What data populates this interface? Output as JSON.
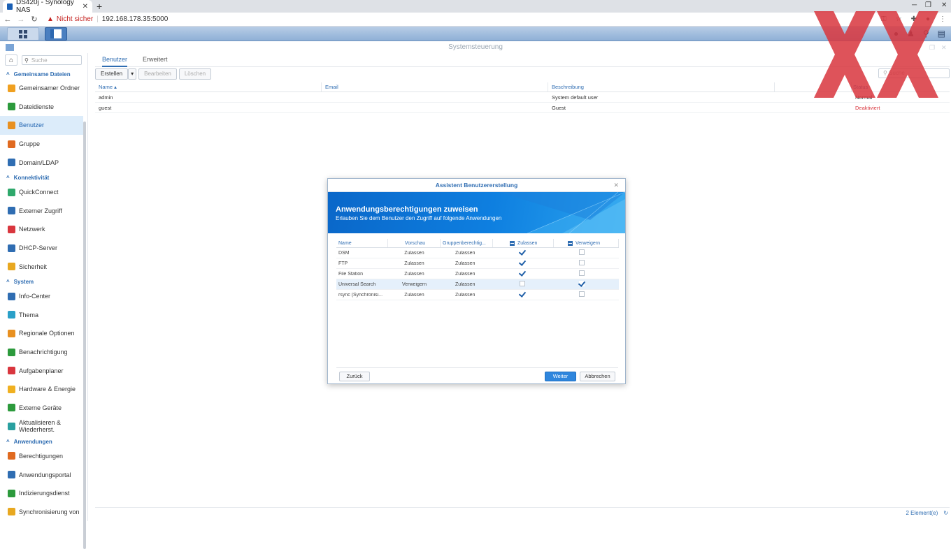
{
  "browser": {
    "tab_title": "DS420j - Synology NAS",
    "not_secure": "Nicht sicher",
    "url": "192.168.178.35:5000"
  },
  "window": {
    "title": "Systemsteuerung"
  },
  "sidebar": {
    "search_placeholder": "Suche",
    "sections": [
      {
        "title": "Gemeinsame Dateien",
        "items": [
          {
            "label": "Gemeinsamer Ordner",
            "icon": "shared-folder-icon",
            "color": "#f0a020"
          },
          {
            "label": "Dateidienste",
            "icon": "file-services-icon",
            "color": "#2c9a3c"
          },
          {
            "label": "Benutzer",
            "icon": "user-icon",
            "color": "#e89020",
            "active": true
          },
          {
            "label": "Gruppe",
            "icon": "group-icon",
            "color": "#e06a20"
          },
          {
            "label": "Domain/LDAP",
            "icon": "domain-icon",
            "color": "#2f6db2"
          }
        ]
      },
      {
        "title": "Konnektivität",
        "items": [
          {
            "label": "QuickConnect",
            "icon": "quickconnect-icon",
            "color": "#2ea86b"
          },
          {
            "label": "Externer Zugriff",
            "icon": "globe-icon",
            "color": "#2f6db2"
          },
          {
            "label": "Netzwerk",
            "icon": "network-icon",
            "color": "#d9363e"
          },
          {
            "label": "DHCP-Server",
            "icon": "dhcp-icon",
            "color": "#2f6db2"
          },
          {
            "label": "Sicherheit",
            "icon": "shield-icon",
            "color": "#e8a820"
          }
        ]
      },
      {
        "title": "System",
        "items": [
          {
            "label": "Info-Center",
            "icon": "info-icon",
            "color": "#2f6db2"
          },
          {
            "label": "Thema",
            "icon": "palette-icon",
            "color": "#2aa0c8"
          },
          {
            "label": "Regionale Optionen",
            "icon": "clock-icon",
            "color": "#e89020"
          },
          {
            "label": "Benachrichtigung",
            "icon": "chat-icon",
            "color": "#2c9a3c"
          },
          {
            "label": "Aufgabenplaner",
            "icon": "calendar-icon",
            "color": "#d9363e"
          },
          {
            "label": "Hardware & Energie",
            "icon": "bulb-icon",
            "color": "#f0b020"
          },
          {
            "label": "Externe Geräte",
            "icon": "external-device-icon",
            "color": "#2c9a3c"
          },
          {
            "label": "Aktualisieren & Wiederherst.",
            "icon": "refresh-icon",
            "color": "#2aa0a0"
          }
        ]
      },
      {
        "title": "Anwendungen",
        "items": [
          {
            "label": "Berechtigungen",
            "icon": "permissions-icon",
            "color": "#e06a20"
          },
          {
            "label": "Anwendungsportal",
            "icon": "portal-icon",
            "color": "#2f6db2"
          },
          {
            "label": "Indizierungsdienst",
            "icon": "index-icon",
            "color": "#2c9a3c"
          },
          {
            "label": "Synchronisierung von",
            "icon": "sync-icon",
            "color": "#e8a820"
          }
        ]
      }
    ]
  },
  "main": {
    "tabs": [
      "Benutzer",
      "Erweitert"
    ],
    "toolbar": {
      "create": "Erstellen",
      "edit": "Bearbeiten",
      "delete": "Löschen"
    },
    "filter_placeholder": "Suche",
    "columns": [
      "Name",
      "Email",
      "Beschreibung",
      "",
      "Status"
    ],
    "users": [
      {
        "name": "admin",
        "email": "",
        "description": "System default user",
        "status": "Normal"
      },
      {
        "name": "guest",
        "email": "",
        "description": "Guest",
        "status": "Deaktiviert"
      }
    ],
    "footer_count": "2 Element(e)"
  },
  "dialog": {
    "title": "Assistent Benutzererstellung",
    "heading": "Anwendungsberechtigungen zuweisen",
    "subheading": "Erlauben Sie dem Benutzer den Zugriff auf folgende Anwendungen",
    "columns": [
      "Name",
      "Vorschau",
      "Gruppenberechtig...",
      "Zulassen",
      "Verweigern"
    ],
    "rows": [
      {
        "name": "DSM",
        "preview": "Zulassen",
        "group": "Zulassen",
        "allow": true,
        "deny": false
      },
      {
        "name": "FTP",
        "preview": "Zulassen",
        "group": "Zulassen",
        "allow": true,
        "deny": false
      },
      {
        "name": "File Station",
        "preview": "Zulassen",
        "group": "Zulassen",
        "allow": true,
        "deny": false
      },
      {
        "name": "Universal Search",
        "preview": "Verweigern",
        "group": "Zulassen",
        "allow": false,
        "deny": true,
        "selected": true
      },
      {
        "name": "rsync (Synchronisi...",
        "preview": "Zulassen",
        "group": "Zulassen",
        "allow": true,
        "deny": false
      }
    ],
    "back": "Zurück",
    "next": "Weiter",
    "cancel": "Abbrechen"
  },
  "colors": {
    "accent": "#2f6db2",
    "primary_button": "#2f86dd",
    "watermark": "#d9363e"
  }
}
